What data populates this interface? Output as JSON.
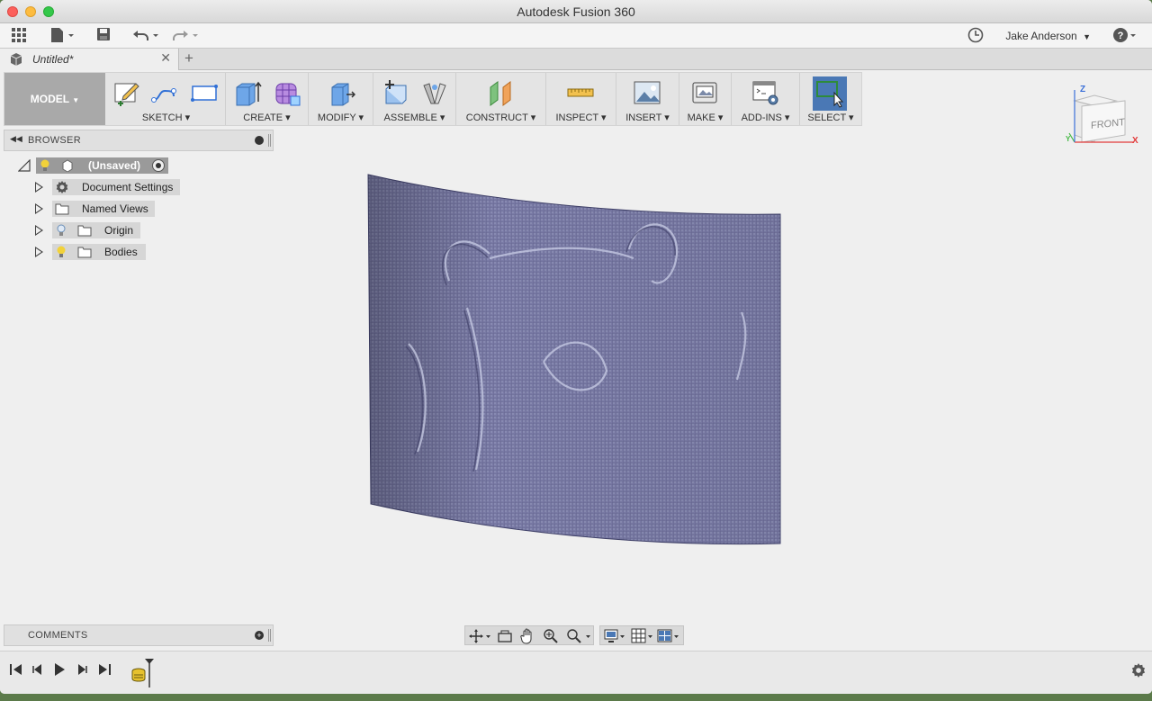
{
  "window": {
    "title": "Autodesk Fusion 360"
  },
  "apptoolbar": {
    "user_name": "Jake Anderson",
    "icons": [
      "grid-icon",
      "file-icon",
      "save-icon",
      "undo-icon",
      "redo-icon",
      "clock-icon",
      "help-icon"
    ]
  },
  "tabs": [
    {
      "label": "Untitled*"
    }
  ],
  "ribbon": {
    "mode": "MODEL",
    "groups": [
      {
        "label": "SKETCH"
      },
      {
        "label": "CREATE"
      },
      {
        "label": "MODIFY"
      },
      {
        "label": "ASSEMBLE"
      },
      {
        "label": "CONSTRUCT"
      },
      {
        "label": "INSPECT"
      },
      {
        "label": "INSERT"
      },
      {
        "label": "MAKE"
      },
      {
        "label": "ADD-INS"
      },
      {
        "label": "SELECT"
      }
    ]
  },
  "browser": {
    "title": "BROWSER",
    "root": "(Unsaved)",
    "items": [
      {
        "label": "Document Settings"
      },
      {
        "label": "Named Views"
      },
      {
        "label": "Origin"
      },
      {
        "label": "Bodies"
      }
    ]
  },
  "comments": {
    "title": "COMMENTS"
  },
  "viewcube": {
    "face": "FRONT",
    "axes": {
      "x": "X",
      "y": "Y",
      "z": "Z"
    },
    "colors": {
      "x": "#e23b3b",
      "y": "#43b843",
      "z": "#3a6fd8"
    }
  },
  "colors": {
    "model_surface": "#7a7ba6",
    "select_accent": "#4a78b5"
  }
}
